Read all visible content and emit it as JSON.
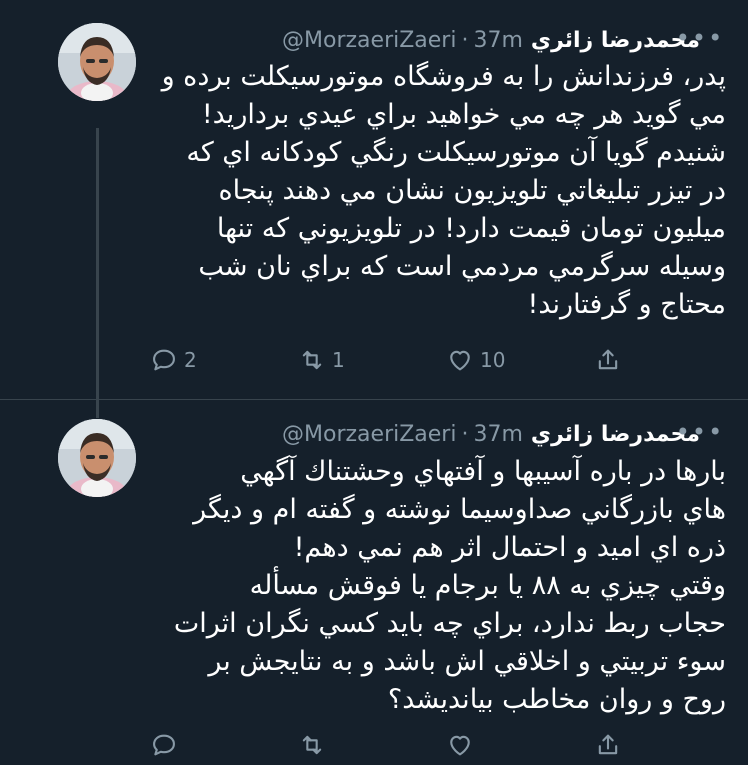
{
  "tweets": [
    {
      "author_name": "محمدرضا زائري",
      "handle": "@MorzaeriZaeri",
      "separator": "·",
      "time": "37m",
      "body_lines": [
        "پدر، فرزندانش را به فروشگاه موتورسيکلت برده و",
        "مي گويد هر چه مي خواهيد براي عيدي برداريد!",
        "شنيدم گويا آن موتورسيکلت رنگي کودکانه اي که",
        "در تيزر تبليغاتي تلويزيون نشان مي دهند پنجاه",
        "ميليون تومان قيمت دارد! در تلويزيوني که تنها",
        "وسيله سرگرمي مردمي است که براي نان شب",
        "محتاج و گرفتارند!"
      ],
      "reply_count": "2",
      "retweet_count": "1",
      "like_count": "10"
    },
    {
      "author_name": "محمدرضا زائري",
      "handle": "@MorzaeriZaeri",
      "separator": "·",
      "time": "37m",
      "body_lines": [
        "بارها در باره آسيبها و آفتهاي وحشتناك آگهي",
        "هاي بازرگاني صداوسيما نوشته و گفته ام و ديگر",
        "ذره اي اميد و احتمال اثر هم نمي دهم!",
        "وقتي چيزي به ۸۸ يا برجام يا فوقش مسأله",
        "حجاب ربط ندارد، براي چه بايد کسي نگران اثرات",
        "سوء تربيتي و اخلاقي اش باشد و به نتايجش بر",
        "روح و روان مخاطب بيانديشد؟"
      ]
    }
  ],
  "icons": {
    "more": "more-horizontal-icon",
    "reply": "reply-icon",
    "retweet": "retweet-icon",
    "like": "heart-icon",
    "share": "share-icon"
  },
  "colors": {
    "background": "#15202b",
    "text": "#ffffff",
    "secondary": "#8899a6",
    "border": "#38444d"
  }
}
